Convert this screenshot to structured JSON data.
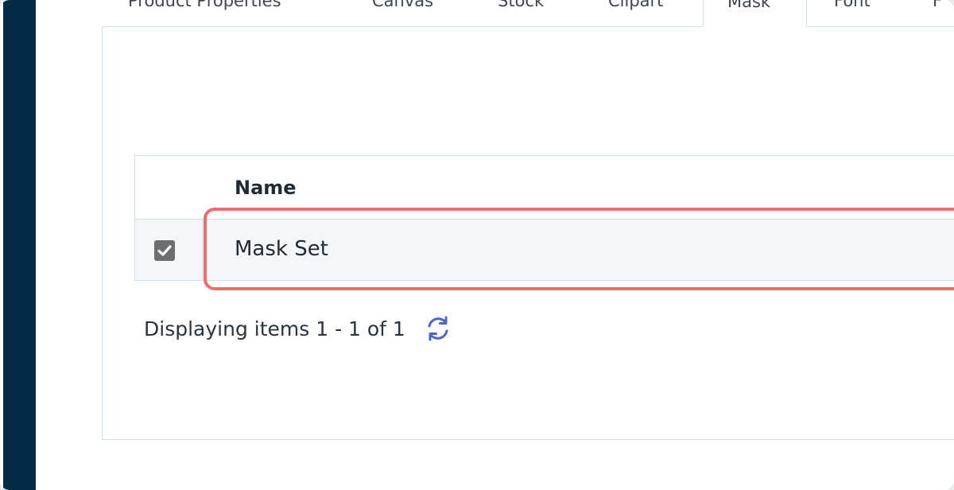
{
  "tabs": [
    {
      "label": "Product Properties"
    },
    {
      "label": "Canvas"
    },
    {
      "label": "Stock"
    },
    {
      "label": "Clipart"
    },
    {
      "label": "Mask"
    },
    {
      "label": "Font"
    },
    {
      "label": "F"
    }
  ],
  "active_tab": "Mask",
  "grid": {
    "header": {
      "name": "Name"
    },
    "rows": [
      {
        "checked": true,
        "name": "Mask Set"
      }
    ]
  },
  "pager": {
    "text": "Displaying items 1 - 1 of 1",
    "refresh_icon": "refresh-icon"
  },
  "colors": {
    "sidebar": "#032b44",
    "highlight": "#f26b6b",
    "border": "#d2e0ea",
    "row_bg": "#f4f7fa",
    "refresh_icon": "#4b67c6"
  }
}
